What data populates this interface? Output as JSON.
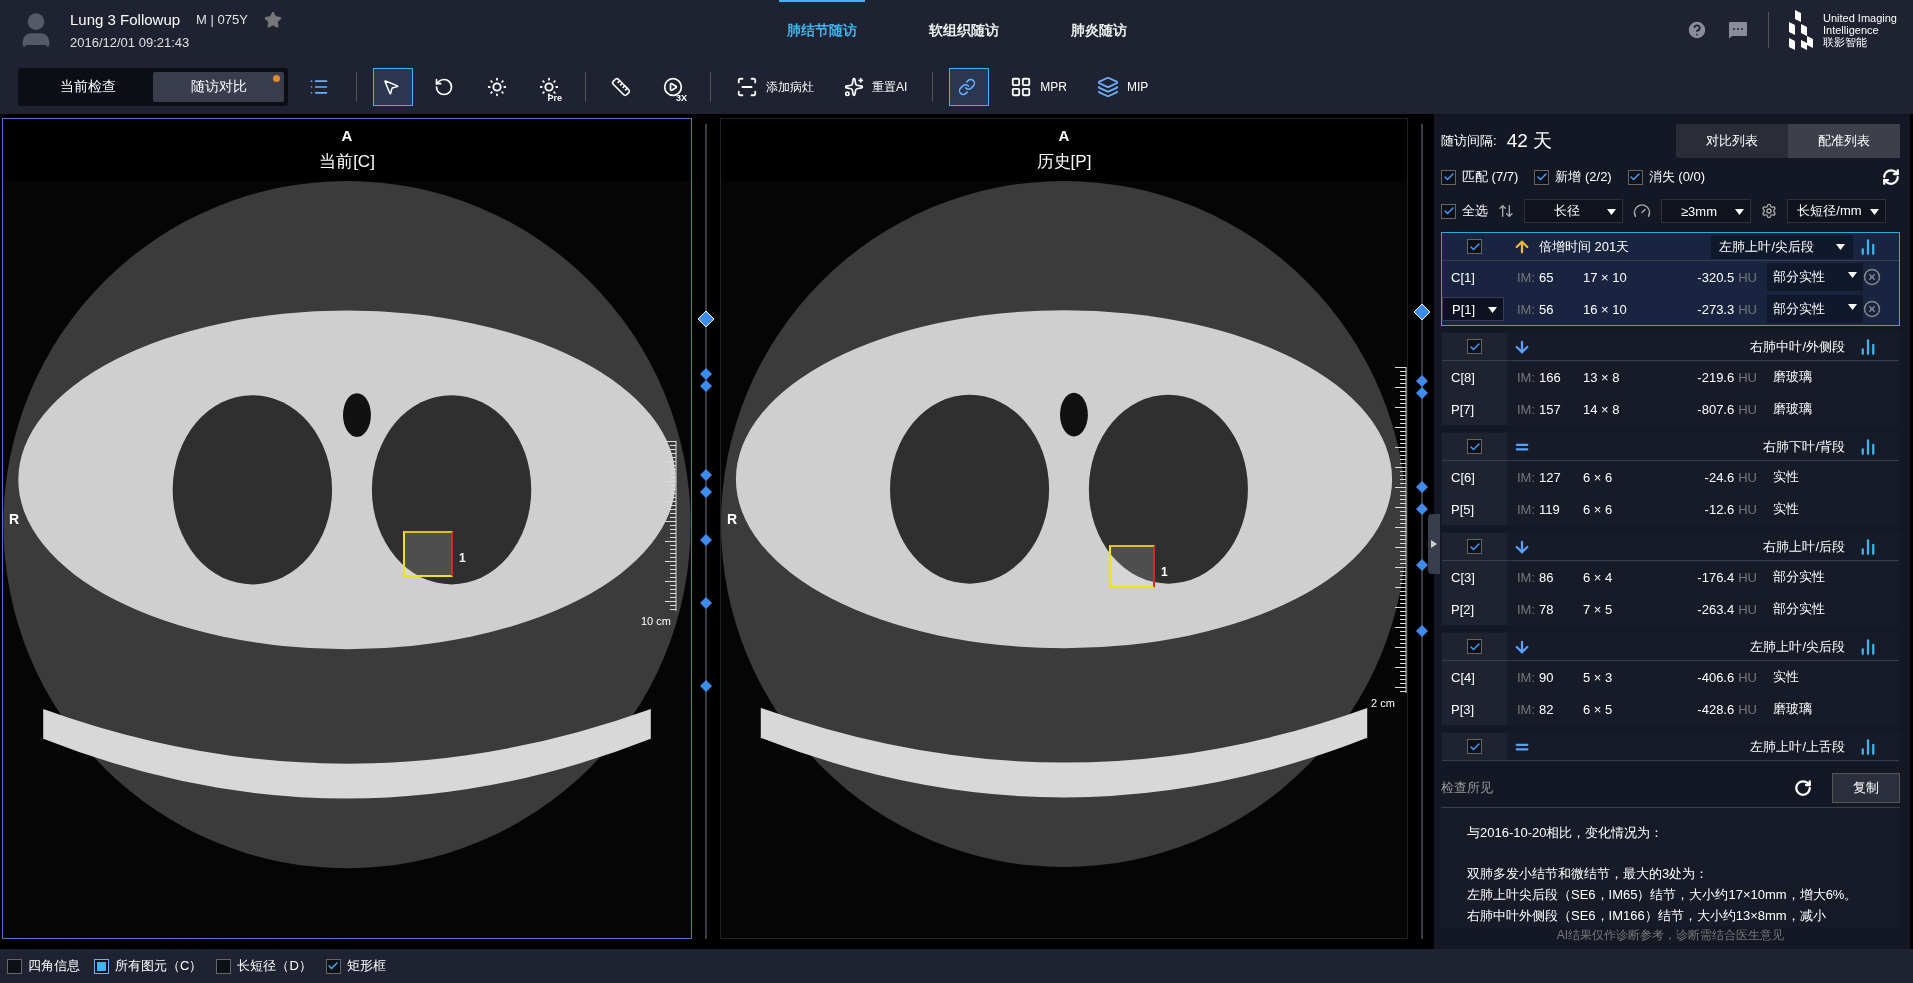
{
  "patient": {
    "name": "Lung 3 Followup",
    "sex_age": "M | 075Y",
    "datetime": "2016/12/01 09:21:43"
  },
  "module_tabs": [
    {
      "label": "肺结节随访",
      "selected": true
    },
    {
      "label": "软组织随访",
      "selected": false
    },
    {
      "label": "肺炎随访",
      "selected": false
    }
  ],
  "logo": {
    "line1": "United Imaging",
    "line2": "Intelligence",
    "line3": "联影智能"
  },
  "mode_tabs": [
    {
      "label": "当前检查",
      "selected": false,
      "badge": false
    },
    {
      "label": "随访对比",
      "selected": true,
      "badge": true
    }
  ],
  "tools": [
    {
      "kind": "list",
      "selected": false
    },
    {
      "kind": "divider"
    },
    {
      "kind": "pointer",
      "selected": true
    },
    {
      "kind": "rotate",
      "selected": false
    },
    {
      "kind": "window",
      "selected": false
    },
    {
      "kind": "preset",
      "selected": false,
      "label": "Pre"
    },
    {
      "kind": "divider"
    },
    {
      "kind": "ruler",
      "selected": false
    },
    {
      "kind": "cine",
      "selected": false,
      "label": "3X"
    },
    {
      "kind": "divider"
    },
    {
      "kind": "add",
      "selected": false,
      "label": "添加病灶"
    },
    {
      "kind": "ai",
      "selected": false,
      "label": "重置AI"
    },
    {
      "kind": "divider"
    },
    {
      "kind": "link",
      "selected": true
    },
    {
      "kind": "mpr",
      "selected": false,
      "label": "MPR"
    },
    {
      "kind": "mip",
      "selected": false,
      "label": "MIP"
    }
  ],
  "viewers": [
    {
      "top": "A",
      "title": "当前[C]",
      "left": "R",
      "marker": "1",
      "scale": "10 cm",
      "selected": true
    },
    {
      "top": "A",
      "title": "历史[P]",
      "left": "R",
      "marker": "1",
      "scale": "2 cm",
      "selected": false
    }
  ],
  "panel": {
    "interval_label": "随访间隔:",
    "interval_value": "42 天",
    "tabs": [
      {
        "label": "对比列表",
        "selected": false
      },
      {
        "label": "配准列表",
        "selected": true
      }
    ],
    "filters": [
      {
        "label": "匹配 (7/7)",
        "checked": true
      },
      {
        "label": "新增 (2/2)",
        "checked": true
      },
      {
        "label": "消失 (0/0)",
        "checked": true
      }
    ],
    "select_all": {
      "label": "全选",
      "checked": true
    },
    "sort": "长径",
    "threshold": "≥3mm",
    "unit": "长短径/mm",
    "groups": [
      {
        "selected": true,
        "checked": true,
        "kind": "up",
        "doubling": "倍增时间 201天",
        "location": "左肺上叶/尖后段",
        "rows": [
          {
            "label": "C[1]",
            "im_label": "IM:",
            "im": "65",
            "size": "17 × 10",
            "hu": "-320.5",
            "hu_unit": "HU",
            "type": "部分实性"
          },
          {
            "label": "P[1]",
            "im_label": "IM:",
            "im": "56",
            "size": "16 × 10",
            "hu": "-273.3",
            "hu_unit": "HU",
            "type": "部分实性"
          }
        ]
      },
      {
        "selected": false,
        "checked": true,
        "kind": "down",
        "location": "右肺中叶/外侧段",
        "rows": [
          {
            "label": "C[8]",
            "im_label": "IM:",
            "im": "166",
            "size": "13 × 8",
            "hu": "-219.6",
            "hu_unit": "HU",
            "type": "磨玻璃"
          },
          {
            "label": "P[7]",
            "im_label": "IM:",
            "im": "157",
            "size": "14 × 8",
            "hu": "-807.6",
            "hu_unit": "HU",
            "type": "磨玻璃"
          }
        ]
      },
      {
        "selected": false,
        "checked": true,
        "kind": "equal",
        "location": "右肺下叶/背段",
        "rows": [
          {
            "label": "C[6]",
            "im_label": "IM:",
            "im": "127",
            "size": "6 × 6",
            "hu": "-24.6",
            "hu_unit": "HU",
            "type": "实性"
          },
          {
            "label": "P[5]",
            "im_label": "IM:",
            "im": "119",
            "size": "6 × 6",
            "hu": "-12.6",
            "hu_unit": "HU",
            "type": "实性"
          }
        ]
      },
      {
        "selected": false,
        "checked": true,
        "kind": "down",
        "location": "右肺上叶/后段",
        "rows": [
          {
            "label": "C[3]",
            "im_label": "IM:",
            "im": "86",
            "size": "6 × 4",
            "hu": "-176.4",
            "hu_unit": "HU",
            "type": "部分实性"
          },
          {
            "label": "P[2]",
            "im_label": "IM:",
            "im": "78",
            "size": "7 × 5",
            "hu": "-263.4",
            "hu_unit": "HU",
            "type": "部分实性"
          }
        ]
      },
      {
        "selected": false,
        "checked": true,
        "kind": "down",
        "location": "左肺上叶/尖后段",
        "rows": [
          {
            "label": "C[4]",
            "im_label": "IM:",
            "im": "90",
            "size": "5 × 3",
            "hu": "-406.6",
            "hu_unit": "HU",
            "type": "实性"
          },
          {
            "label": "P[3]",
            "im_label": "IM:",
            "im": "82",
            "size": "6 × 5",
            "hu": "-428.6",
            "hu_unit": "HU",
            "type": "磨玻璃"
          }
        ]
      },
      {
        "selected": false,
        "checked": true,
        "kind": "equal",
        "location": "左肺上叶/上舌段"
      }
    ],
    "findings": {
      "title": "检查所见",
      "copy": "复制",
      "blocks": [
        [
          "与2016-10-20相比，变化情况为："
        ],
        [
          "双肺多发小结节和微结节，最大的3处为：",
          "左肺上叶尖后段（SE6，IM65）结节，大小约17×10mm，增大6%。",
          "右肺中叶外侧段（SE6，IM166）结节，大小约13×8mm，减小"
        ]
      ]
    },
    "disclaimer": "AI结果仅作诊断参考，诊断需结合医生意见"
  },
  "overlay_options": [
    {
      "label": "四角信息",
      "kind": "tick",
      "checked": false
    },
    {
      "label": "所有图元（C）",
      "kind": "square",
      "checked": true
    },
    {
      "label": "长短径（D）",
      "kind": "tick",
      "checked": false
    },
    {
      "label": "矩形框",
      "kind": "tick",
      "checked": true
    }
  ]
}
